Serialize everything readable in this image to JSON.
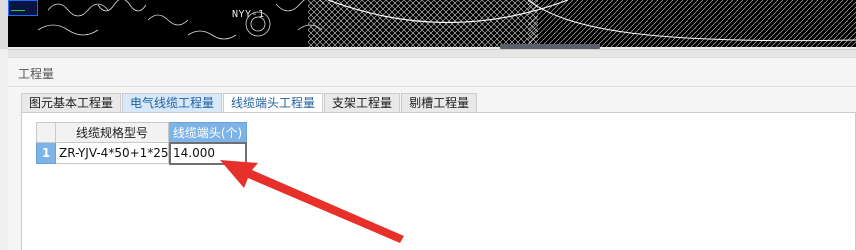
{
  "cad": {
    "drawing_label": "NYY-1"
  },
  "panel": {
    "title": "工程量"
  },
  "tabs": [
    {
      "label": "图元基本工程量",
      "state": "normal"
    },
    {
      "label": "电气线缆工程量",
      "state": "highlighted"
    },
    {
      "label": "线缆端头工程量",
      "state": "active"
    },
    {
      "label": "支架工程量",
      "state": "normal"
    },
    {
      "label": "剔槽工程量",
      "state": "normal"
    }
  ],
  "grid": {
    "columns": [
      "线缆规格型号",
      "线缆端头(个)"
    ],
    "rows": [
      {
        "row_number": "1",
        "spec": "ZR-YJV-4*50+1*25",
        "count": "14.000"
      }
    ]
  },
  "annotation": {
    "color": "#e8302a",
    "shape": "arrow pointing to selected cell"
  },
  "colors": {
    "tab_active_text": "#1e5f9e",
    "header_selected_bg": "#7db3e6",
    "cad_background": "#000000"
  }
}
